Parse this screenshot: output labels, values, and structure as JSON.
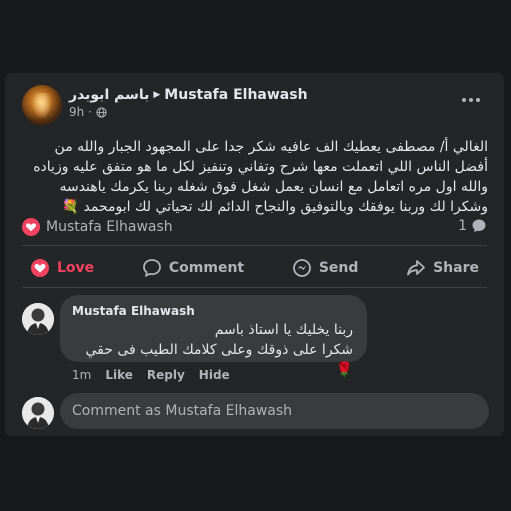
{
  "post": {
    "author": "باسم ابوبدر",
    "recipient": "Mustafa Elhawash",
    "time": "9h ·",
    "text": "الغالي أ/ مصطفى يعطيك الف عافيه شكر جدا على المجهود الجبار والله من أفضل الناس اللي اتعملت معها شرح وتفاني وتنفيز لكل ما هو متفق عليه وزياده والله اول مره اتعامل مع انسان يعمل شغل فوق شغله ربنا يكرمك ياهندسه وشكرا لك وربنا يوفقك وبالتوفيق والنجاح الدائم لك تحياتي لك ابومحمد 💐",
    "reaction_name": "Mustafa Elhawash",
    "comment_count": "1"
  },
  "actions": {
    "love": "Love",
    "comment": "Comment",
    "send": "Send",
    "share": "Share"
  },
  "comment": {
    "author": "Mustafa Elhawash",
    "line1": "ربنا يخليك يا استاذ باسم",
    "line2": "شكرا على ذوقك وعلى كلامك الطيب فى حقي 🌹",
    "time": "1m",
    "like": "Like",
    "reply": "Reply",
    "hide": "Hide"
  },
  "composer": {
    "placeholder": "Comment as Mustafa Elhawash"
  },
  "colors": {
    "background": "#18191a",
    "card": "#242526",
    "bubble": "#3a3b3c",
    "love_accent": "#f3425f",
    "muted_text": "#b0b3b8"
  },
  "icons": [
    "globe-icon",
    "more-icon",
    "love-icon",
    "comment-icon",
    "send-icon",
    "share-icon",
    "comment-count-icon"
  ]
}
